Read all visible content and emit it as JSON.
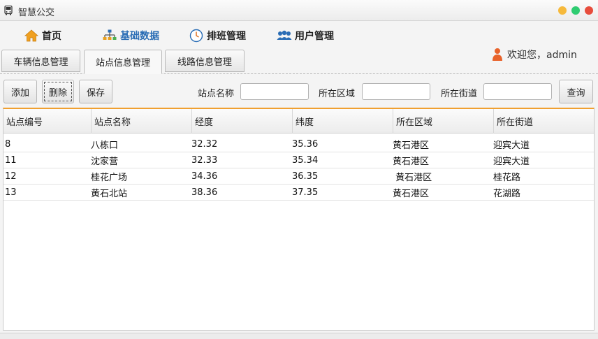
{
  "window": {
    "title": "智慧公交",
    "app_icon": "bus-icon",
    "controls": [
      "minimize-icon",
      "maximize-icon",
      "close-icon"
    ],
    "control_colors": {
      "minimize": "#f6b93b",
      "maximize": "#2ecc71",
      "close": "#e74c3c"
    }
  },
  "nav": {
    "items": [
      {
        "label": "首页",
        "icon": "home-icon"
      },
      {
        "label": "基础数据",
        "icon": "sitemap-icon",
        "active": true
      },
      {
        "label": "排班管理",
        "icon": "clock-icon"
      },
      {
        "label": "用户管理",
        "icon": "users-icon"
      }
    ],
    "welcome": "欢迎您，admin",
    "welcome_icon": "user-icon",
    "active_color": "#2a6db5"
  },
  "subtabs": {
    "items": [
      "车辆信息管理",
      "站点信息管理",
      "线路信息管理"
    ],
    "selected": "站点信息管理"
  },
  "toolbar": {
    "add_label": "添加",
    "delete_label": "删除",
    "save_label": "保存",
    "query_label": "查询",
    "filters": [
      {
        "label": "站点名称",
        "value": ""
      },
      {
        "label": "所在区域",
        "value": ""
      },
      {
        "label": "所在街道",
        "value": ""
      }
    ]
  },
  "table": {
    "accent_color": "#f0a030",
    "columns": [
      "站点编号",
      "站点名称",
      "经度",
      "纬度",
      "所在区域",
      "所在街道"
    ],
    "rows": [
      [
        "8",
        "八栋口",
        "32.32",
        "35.36",
        "黄石港区",
        "迎宾大道"
      ],
      [
        "11",
        "沈家营",
        "32.33",
        "35.34",
        "黄石港区",
        "迎宾大道"
      ],
      [
        "12",
        "桂花广场",
        "34.36",
        "36.35",
        " 黄石港区",
        "桂花路"
      ],
      [
        "13",
        "黄石北站",
        "38.36",
        "37.35",
        "黄石港区",
        "花湖路"
      ]
    ]
  }
}
